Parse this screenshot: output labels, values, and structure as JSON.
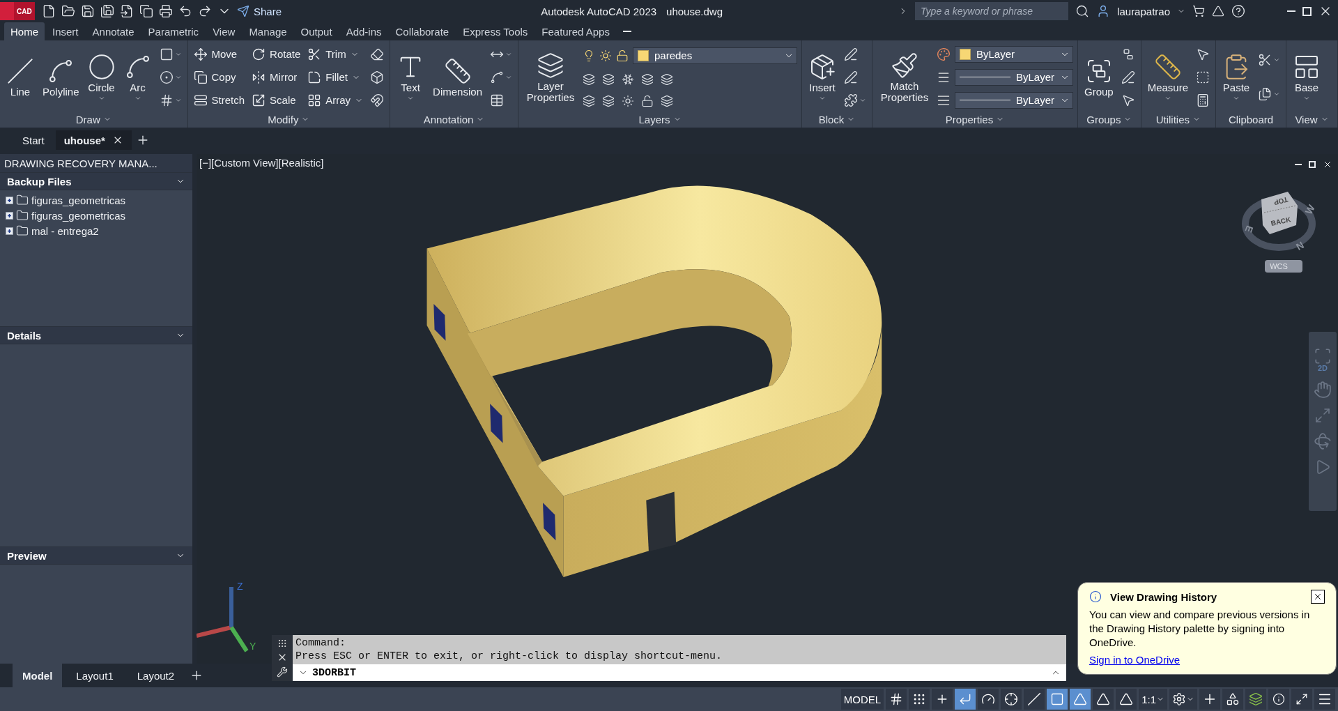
{
  "title_bar": {
    "logo": "CAD",
    "share": "Share",
    "app": "Autodesk AutoCAD 2023",
    "file": "uhouse.dwg",
    "search": {
      "placeholder": "Type a keyword or phrase"
    },
    "user": "laurapatrao"
  },
  "ribbon_tabs": [
    {
      "label": "Home",
      "selected": true
    },
    {
      "label": "Insert",
      "selected": false
    },
    {
      "label": "Annotate",
      "selected": false
    },
    {
      "label": "Parametric",
      "selected": false
    },
    {
      "label": "View",
      "selected": false
    },
    {
      "label": "Manage",
      "selected": false
    },
    {
      "label": "Output",
      "selected": false
    },
    {
      "label": "Add-ins",
      "selected": false
    },
    {
      "label": "Collaborate",
      "selected": false
    },
    {
      "label": "Express Tools",
      "selected": false
    },
    {
      "label": "Featured Apps",
      "selected": false
    }
  ],
  "ribbon_panels": [
    {
      "title": "Draw",
      "menu": true,
      "tools": [
        {
          "kind": "large",
          "label": "Line"
        },
        {
          "kind": "large",
          "label": "Polyline"
        },
        {
          "kind": "large",
          "label": "Circle",
          "dropdown": true
        },
        {
          "kind": "large",
          "label": "Arc",
          "dropdown": true
        }
      ]
    },
    {
      "title": "Modify",
      "menu": true,
      "tools": [
        {
          "kind": "small",
          "label": "Move"
        },
        {
          "kind": "small",
          "label": "Copy"
        },
        {
          "kind": "small",
          "label": "Stretch"
        },
        {
          "kind": "small",
          "label": "Rotate"
        },
        {
          "kind": "small",
          "label": "Mirror"
        },
        {
          "kind": "small",
          "label": "Scale"
        },
        {
          "kind": "small",
          "label": "Trim",
          "dropdown": true
        },
        {
          "kind": "small",
          "label": "Fillet",
          "dropdown": true
        },
        {
          "kind": "small",
          "label": "Array",
          "dropdown": true
        }
      ]
    },
    {
      "title": "Annotation",
      "menu": true,
      "tools": [
        {
          "kind": "large",
          "label": "Text",
          "dropdown": true
        },
        {
          "kind": "large",
          "label": "Dimension"
        }
      ]
    },
    {
      "title": "Layers",
      "menu": true,
      "tools": [
        {
          "kind": "large",
          "label": "Layer Properties"
        },
        {
          "kind": "combo",
          "value": "paredes",
          "color": "#f7d774"
        }
      ]
    },
    {
      "title": "Block",
      "menu": true,
      "tools": [
        {
          "kind": "large",
          "label": "Insert",
          "dropdown": true
        }
      ]
    },
    {
      "title": "Properties",
      "menu": true,
      "tools": [
        {
          "kind": "large",
          "label": "Match Properties"
        },
        {
          "kind": "combo",
          "value": "ByLayer",
          "color": "#f7d774"
        },
        {
          "kind": "line-combo",
          "value": "ByLayer"
        },
        {
          "kind": "line-combo",
          "value": "ByLayer"
        }
      ]
    },
    {
      "title": "Groups",
      "menu": true,
      "tools": [
        {
          "kind": "large",
          "label": "Group"
        }
      ]
    },
    {
      "title": "Utilities",
      "menu": true,
      "tools": [
        {
          "kind": "large",
          "label": "Measure",
          "dropdown": true
        }
      ]
    },
    {
      "title": "Clipboard",
      "menu": false,
      "tools": [
        {
          "kind": "large",
          "label": "Paste",
          "dropdown": true
        }
      ]
    },
    {
      "title": "View",
      "menu": true,
      "tools": [
        {
          "kind": "large",
          "label": "Base",
          "dropdown": true
        }
      ]
    }
  ],
  "file_tabs": [
    {
      "label": "Start",
      "selected": false
    },
    {
      "label": "uhouse*",
      "selected": true
    }
  ],
  "recovery_panel": {
    "title": "DRAWING RECOVERY MANA...",
    "sections": [
      {
        "title": "Backup Files",
        "items": [
          {
            "label": "figuras_geometricas",
            "expanded": false
          },
          {
            "label": "figuras_geometricas",
            "expanded": false
          },
          {
            "label": "mal - entrega2",
            "expanded": false
          }
        ]
      },
      {
        "title": "Details"
      },
      {
        "title": "Preview"
      }
    ]
  },
  "viewport": {
    "label": "[−][Custom View][Realistic]",
    "viewcube": {
      "top": "TOP",
      "front": "BACK",
      "compass": [
        "W",
        "N",
        "E"
      ],
      "ucs": "WCS"
    },
    "ucs_axes": [
      "Z",
      "Y"
    ],
    "nav_badge": "2D"
  },
  "command_line": {
    "history": [
      "Command:",
      "Press ESC or ENTER to exit, or right-click to display shortcut-menu."
    ],
    "input": "3DORBIT"
  },
  "layout_tabs": [
    {
      "label": "Model",
      "selected": true
    },
    {
      "label": "Layout1",
      "selected": false
    },
    {
      "label": "Layout2",
      "selected": false
    }
  ],
  "status_bar": {
    "mode": "MODEL",
    "scale": "1:1",
    "toggles": [
      {
        "on": false
      },
      {
        "on": false
      },
      {
        "on": false
      },
      {
        "on": true
      },
      {
        "on": false
      },
      {
        "on": false
      },
      {
        "on": false
      },
      {
        "on": true
      },
      {
        "on": true
      },
      {
        "on": false
      },
      {
        "on": false
      }
    ]
  },
  "notification": {
    "title": "View Drawing History",
    "body": "You can view and compare previous versions in the Drawing History palette by signing into OneDrive.",
    "link": "Sign in to OneDrive"
  }
}
